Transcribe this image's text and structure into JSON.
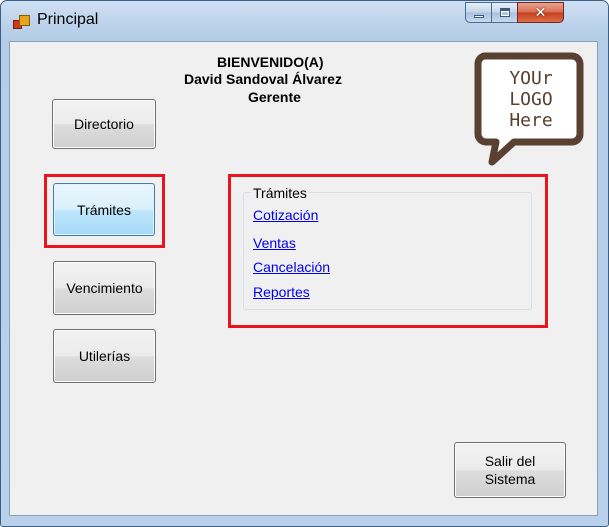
{
  "window": {
    "title": "Principal",
    "controls": {
      "minimize": "minimize",
      "maximize": "maximize",
      "close": "close"
    }
  },
  "welcome": {
    "greeting": "BIENVENIDO(A)",
    "user_name": "David Sandoval Álvarez",
    "role": "Gerente"
  },
  "nav_buttons": [
    {
      "label": "Directorio",
      "selected": false
    },
    {
      "label": "Trámites",
      "selected": true
    },
    {
      "label": "Vencimiento",
      "selected": false
    },
    {
      "label": "Utilerías",
      "selected": false
    }
  ],
  "tramites_group": {
    "title": "Trámites",
    "links": [
      "Cotización",
      "Ventas",
      "Cancelación",
      "Reportes"
    ]
  },
  "logo": {
    "line1": "YOUr",
    "line2": "LOGO",
    "line3": "Here"
  },
  "exit_button": {
    "line1": "Salir del",
    "line2": "Sistema"
  },
  "colors": {
    "highlight": "#e8141e",
    "link": "#0000ee",
    "logo_brown": "#5a4030"
  }
}
